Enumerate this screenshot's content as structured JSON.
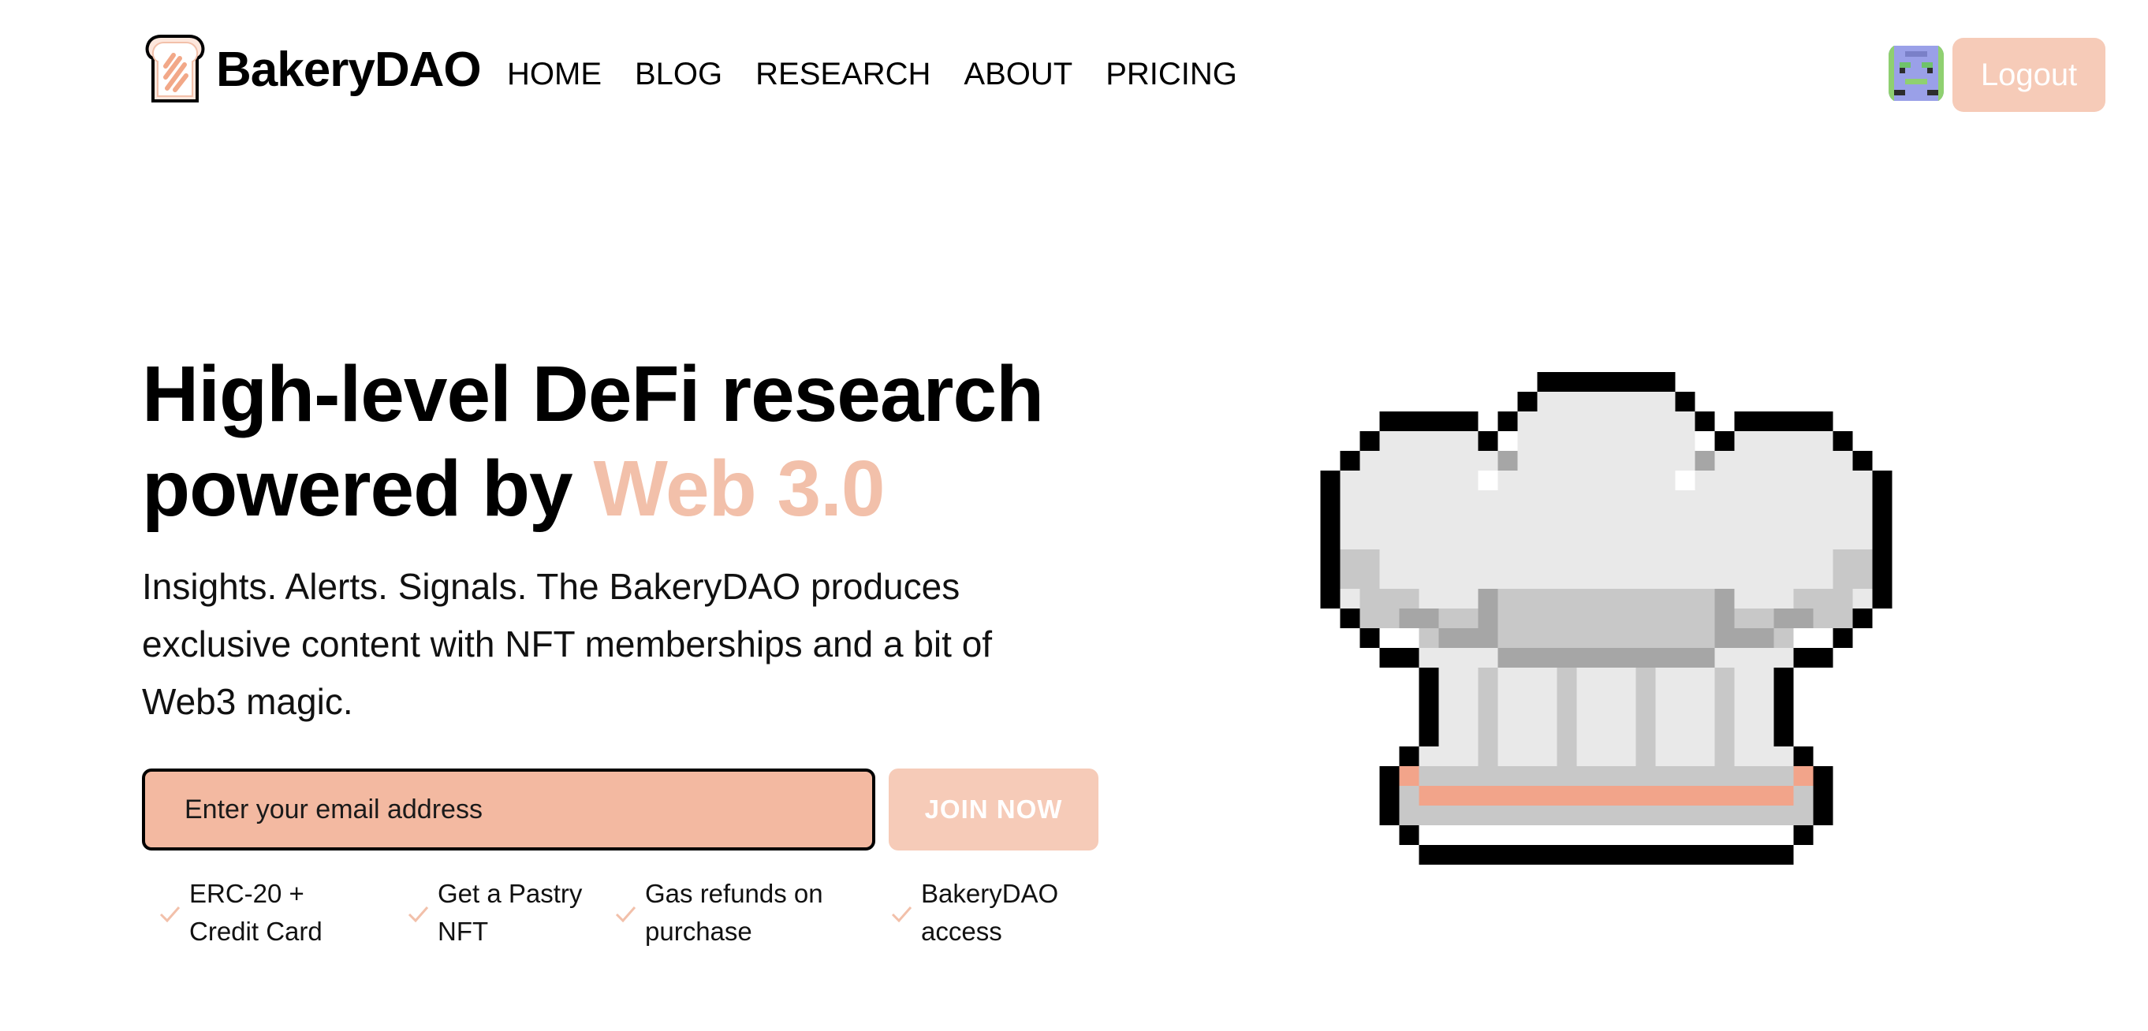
{
  "brand": {
    "name": "BakeryDAO",
    "logo_icon": "toast-logo-icon",
    "accent_color": "#f2c0aa"
  },
  "nav": {
    "links": [
      "HOME",
      "BLOG",
      "RESEARCH",
      "ABOUT",
      "PRICING"
    ],
    "avatar_icon": "pixel-avatar-icon",
    "logout_label": "Logout"
  },
  "hero": {
    "title_line1": "High-level DeFi research",
    "title_line2_prefix": "powered by ",
    "title_line2_accent": "Web 3.0",
    "subtitle": "Insights. Alerts. Signals. The BakeryDAO produces exclusive content with NFT memberships and a bit of Web3 magic.",
    "email_placeholder": "Enter your email address",
    "join_label": "JOIN NOW",
    "illustration_icon": "pixel-chef-hat-icon"
  },
  "features": [
    {
      "line1": "ERC-20 +",
      "line2": "Credit Card",
      "icon": "check-icon"
    },
    {
      "line1": "Get a Pastry",
      "line2": "NFT",
      "icon": "check-icon"
    },
    {
      "line1": "Gas refunds on",
      "line2": "purchase",
      "icon": "check-icon"
    },
    {
      "line1": "BakeryDAO",
      "line2": "access",
      "icon": "check-icon"
    }
  ],
  "colors": {
    "input_bg": "#f3b9a1",
    "button_bg": "#f6cbb8",
    "check": "#f2c0aa"
  }
}
